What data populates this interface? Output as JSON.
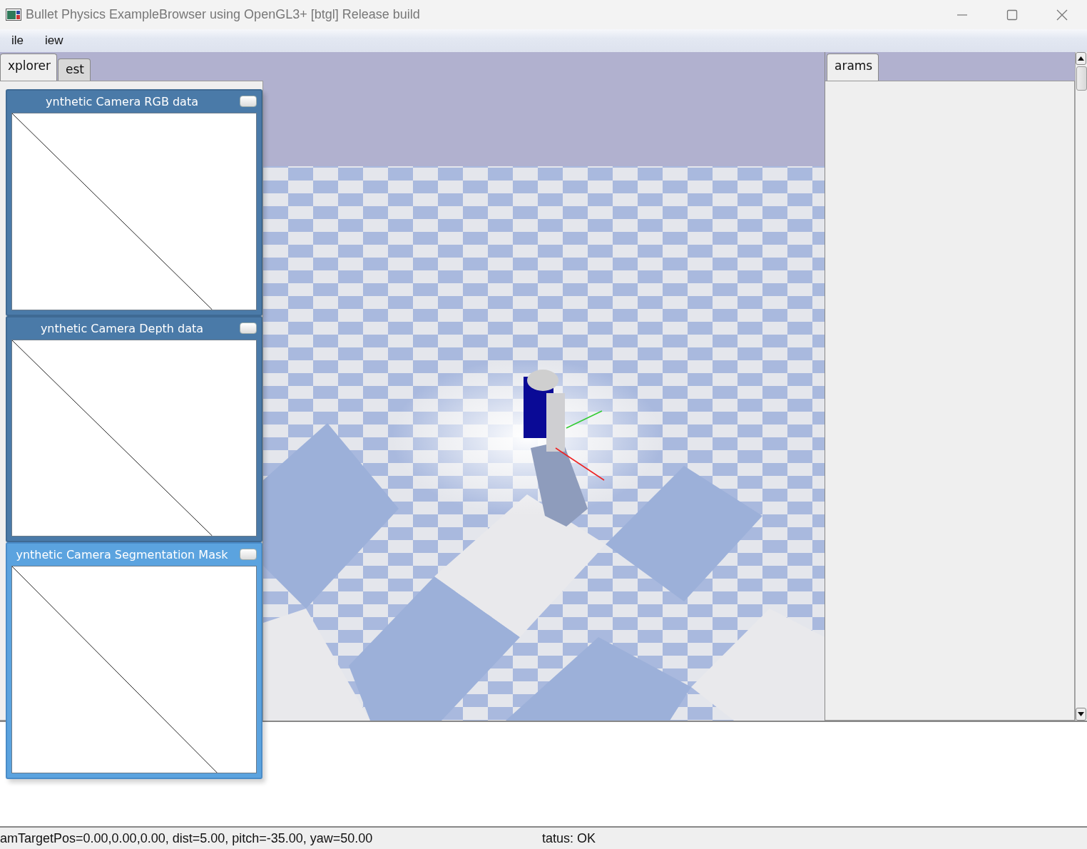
{
  "window": {
    "title": "Bullet Physics ExampleBrowser using OpenGL3+ [btgl] Release build"
  },
  "menu": [
    {
      "label": "ile"
    },
    {
      "label": "iew"
    }
  ],
  "left_tabs": [
    {
      "label": "xplorer",
      "selected": true
    },
    {
      "label": "est",
      "selected": false
    }
  ],
  "camera_windows": [
    {
      "title": "ynthetic Camera RGB data",
      "active": false
    },
    {
      "title": "ynthetic Camera Depth data",
      "active": false
    },
    {
      "title": "ynthetic Camera Segmentation Mask",
      "active": true
    }
  ],
  "right_tabs": [
    {
      "label": "arams",
      "selected": true
    }
  ],
  "status_bar": {
    "camera": "amTargetPos=0.00,0.00,0.00, dist=5.00, pitch=-35.00, yaw=50.00",
    "status": "tatus: OK"
  }
}
